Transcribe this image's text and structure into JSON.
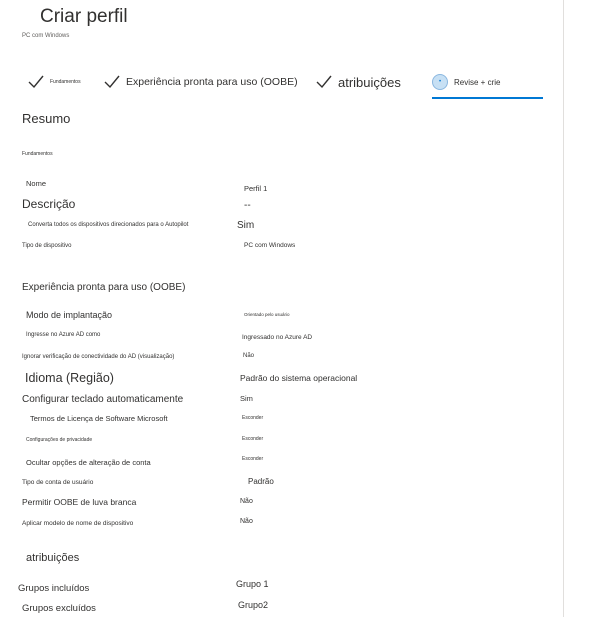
{
  "page": {
    "title": "Criar perfil",
    "subtitle": "PC com Windows"
  },
  "steps": [
    {
      "label": "Fundamentos",
      "state": "done"
    },
    {
      "label": "Experiência pronta para uso (OOBE)",
      "state": "done"
    },
    {
      "label": "atribuições",
      "state": "done"
    },
    {
      "label": "Revise + crie",
      "state": "current"
    }
  ],
  "summary": {
    "heading": "Resumo",
    "basics": {
      "heading": "Fundamentos",
      "rows": [
        {
          "label": "Nome",
          "value": "Perfil 1"
        },
        {
          "label": "Descrição",
          "value": "--"
        },
        {
          "label": "Converta todos os dispositivos direcionados para o Autopilot",
          "value": "Sim"
        },
        {
          "label": "Tipo de dispositivo",
          "value": "PC com Windows"
        }
      ]
    },
    "oobe": {
      "heading": "Experiência pronta para uso (OOBE)",
      "rows": [
        {
          "label": "Modo de implantação",
          "value": "Orientado pelo usuário"
        },
        {
          "label": "Ingresse no Azure AD como",
          "value": "Ingressado no Azure AD"
        },
        {
          "label": "Ignorar verificação de conectividade do AD (visualização)",
          "value": "Não"
        },
        {
          "label": "Idioma (Região)",
          "value": "Padrão do sistema operacional"
        },
        {
          "label": "Configurar teclado automaticamente",
          "value": "Sim"
        },
        {
          "label": "Termos de Licença de Software Microsoft",
          "value": "Esconder"
        },
        {
          "label": "Configurações de privacidade",
          "value": "Esconder"
        },
        {
          "label": "Ocultar opções de alteração de conta",
          "value": "Esconder"
        },
        {
          "label": "Tipo de conta de usuário",
          "value": "Padrão"
        },
        {
          "label": "Permitir OOBE de luva branca",
          "value": "Não"
        },
        {
          "label": "Aplicar modelo de nome de dispositivo",
          "value": "Não"
        }
      ]
    },
    "assignments": {
      "heading": "atribuições",
      "rows": [
        {
          "label": "Grupos incluídos",
          "value": "Grupo 1"
        },
        {
          "label": "Grupos excluídos",
          "value": "Grupo2"
        }
      ]
    }
  },
  "colors": {
    "accent": "#0078d4",
    "text": "#323130",
    "muted": "#605e5c"
  },
  "icons": {
    "done": "checkmark-icon",
    "current": "current-step-icon"
  }
}
